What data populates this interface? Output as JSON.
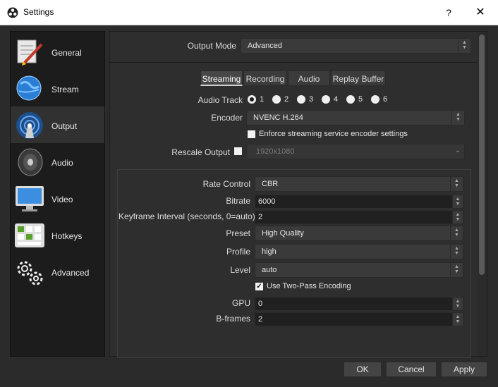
{
  "window": {
    "title": "Settings",
    "help": "?",
    "close": "✕"
  },
  "sidebar": {
    "items": [
      {
        "label": "General",
        "icon": "general-icon"
      },
      {
        "label": "Stream",
        "icon": "stream-globe-icon"
      },
      {
        "label": "Output",
        "icon": "output-broadcast-icon",
        "active": true
      },
      {
        "label": "Audio",
        "icon": "speaker-icon"
      },
      {
        "label": "Video",
        "icon": "monitor-icon"
      },
      {
        "label": "Hotkeys",
        "icon": "keyboard-icon"
      },
      {
        "label": "Advanced",
        "icon": "gears-icon"
      }
    ]
  },
  "output_mode": {
    "label": "Output Mode",
    "value": "Advanced"
  },
  "tabs": [
    {
      "label": "Streaming",
      "active": true
    },
    {
      "label": "Recording"
    },
    {
      "label": "Audio"
    },
    {
      "label": "Replay Buffer"
    }
  ],
  "streaming": {
    "audio_track": {
      "label": "Audio Track",
      "options": [
        "1",
        "2",
        "3",
        "4",
        "5",
        "6"
      ],
      "selected": "1"
    },
    "encoder": {
      "label": "Encoder",
      "value": "NVENC H.264"
    },
    "enforce": {
      "label": "Enforce streaming service encoder settings",
      "checked": false
    },
    "rescale": {
      "label": "Rescale Output",
      "checked": false,
      "value": "1920x1080"
    }
  },
  "encoder_settings": {
    "rate_control": {
      "label": "Rate Control",
      "value": "CBR"
    },
    "bitrate": {
      "label": "Bitrate",
      "value": "6000"
    },
    "keyframe": {
      "label": "Keyframe Interval (seconds, 0=auto)",
      "value": "2"
    },
    "preset": {
      "label": "Preset",
      "value": "High Quality"
    },
    "profile": {
      "label": "Profile",
      "value": "high"
    },
    "level": {
      "label": "Level",
      "value": "auto"
    },
    "two_pass": {
      "label": "Use Two-Pass Encoding",
      "checked": true
    },
    "gpu": {
      "label": "GPU",
      "value": "0"
    },
    "bframes": {
      "label": "B-frames",
      "value": "2"
    }
  },
  "buttons": {
    "ok": "OK",
    "cancel": "Cancel",
    "apply": "Apply"
  }
}
